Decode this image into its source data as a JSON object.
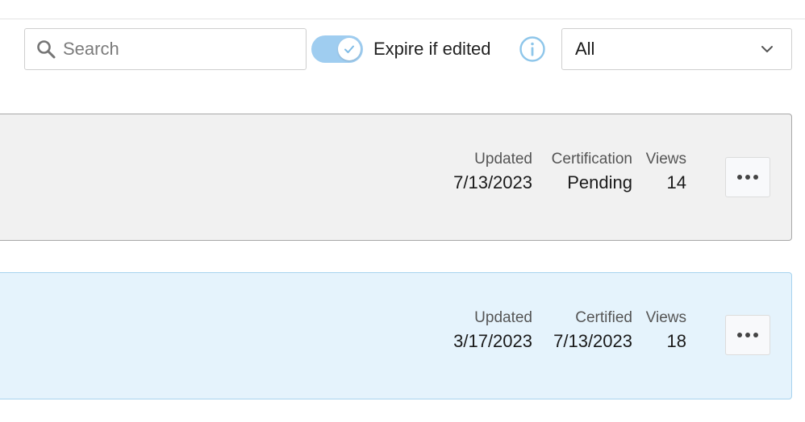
{
  "search": {
    "placeholder": "Search",
    "value": "",
    "icon": "search-icon"
  },
  "toggle": {
    "label": "Expire if edited",
    "on": true,
    "color": "#9fcdf0"
  },
  "info": {
    "icon": "info-icon",
    "color": "#8ec6ea"
  },
  "filter": {
    "selected": "All",
    "icon": "chevron-down-icon"
  },
  "cards": [
    {
      "updated_label": "Updated",
      "updated_value": "7/13/2023",
      "cert_label": "Certification",
      "cert_value": "Pending",
      "views_label": "Views",
      "views_value": "14",
      "background": "#f1f1f1"
    },
    {
      "updated_label": "Updated",
      "updated_value": "3/17/2023",
      "cert_label": "Certified",
      "cert_value": "7/13/2023",
      "views_label": "Views",
      "views_value": "18",
      "background": "#e5f3fc"
    }
  ]
}
